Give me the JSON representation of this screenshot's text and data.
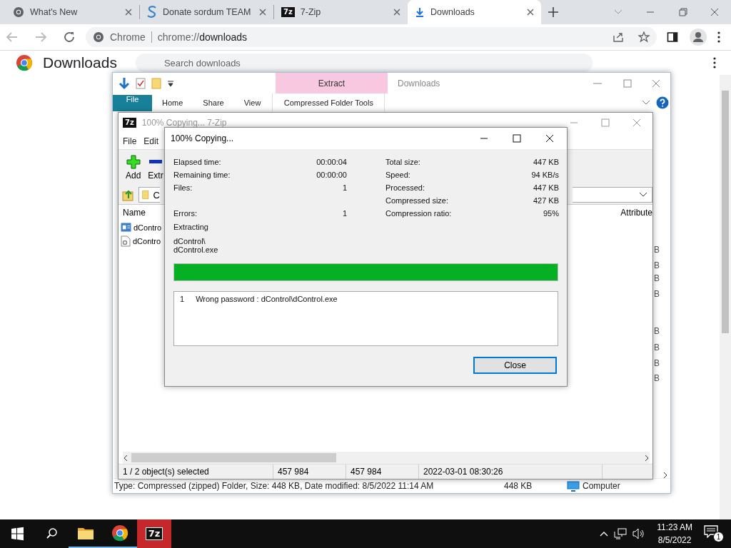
{
  "browser": {
    "tabs": [
      {
        "title": "What's New",
        "kind": "chrome",
        "selected": false
      },
      {
        "title": "Donate sordum TEAM",
        "kind": "sordum",
        "selected": false
      },
      {
        "title": "7-Zip",
        "kind": "sevenzip",
        "icon_text": "7z",
        "selected": false
      },
      {
        "title": "Downloads",
        "kind": "download",
        "selected": true
      }
    ],
    "omnibox": {
      "site": "Chrome",
      "url_scheme": "chrome://",
      "url_path": "downloads"
    },
    "page": {
      "title": "Downloads",
      "search_placeholder": "Search downloads"
    }
  },
  "explorer": {
    "title": "Downloads",
    "context_tab": "Extract",
    "ribbon_tabs": [
      {
        "label": "File",
        "kind": "file"
      },
      {
        "label": "Home",
        "kind": "plain"
      },
      {
        "label": "Share",
        "kind": "plain"
      },
      {
        "label": "View",
        "kind": "plain"
      },
      {
        "label": "Compressed Folder Tools",
        "kind": "context"
      }
    ],
    "size_fragments": [
      "B",
      "B",
      "B",
      "B",
      "B",
      "B",
      "B",
      "B"
    ],
    "status": {
      "details": "Type: Compressed (zipped) Folder, Size: 448 KB, Date modified: 8/5/2022 11:14 AM",
      "size": "448 KB",
      "location": "Computer"
    }
  },
  "sevenzip": {
    "title": "100% Copying... 7-Zip",
    "icon_text": "7z",
    "menu": [
      "File",
      "Edit"
    ],
    "toolbar": [
      "Add",
      "Extr"
    ],
    "path": "C",
    "columns": [
      "Name",
      "Attribute"
    ],
    "rows": [
      {
        "name": "dContro",
        "kind": "archive"
      },
      {
        "name": "dContro",
        "kind": "executable"
      }
    ],
    "status": [
      "1 / 2 object(s) selected",
      "457 984",
      "457 984",
      "2022-03-01 08:30:26"
    ]
  },
  "dialog": {
    "title": "100% Copying...",
    "left_stats": [
      {
        "label": "Elapsed time:",
        "value": "00:00:04"
      },
      {
        "label": "Remaining time:",
        "value": "00:00:00"
      },
      {
        "label": "Files:",
        "value": "1"
      },
      {
        "label": "Errors:",
        "value": "1"
      }
    ],
    "right_stats": [
      {
        "label": "Total size:",
        "value": "447 KB"
      },
      {
        "label": "Speed:",
        "value": "94 KB/s"
      },
      {
        "label": "Processed:",
        "value": "447 KB"
      },
      {
        "label": "Compressed size:",
        "value": "427 KB"
      },
      {
        "label": "Compression ratio:",
        "value": "95%"
      }
    ],
    "operation": "Extracting",
    "current_file": [
      "dControl\\",
      "dControl.exe"
    ],
    "progress": {
      "level": 1
    },
    "messages": [
      {
        "number": "1",
        "text": "Wrong password : dControl\\dControl.exe"
      }
    ],
    "close_button": "Close"
  },
  "taskbar": {
    "apps": [
      {
        "kind": "explorer",
        "selected": false
      },
      {
        "kind": "chrome",
        "selected": false
      },
      {
        "kind": "sevenzip",
        "icon_text": "7z",
        "selected": true
      }
    ],
    "time": "11:23 AM",
    "date": "8/5/2022",
    "notification_count": "1"
  }
}
